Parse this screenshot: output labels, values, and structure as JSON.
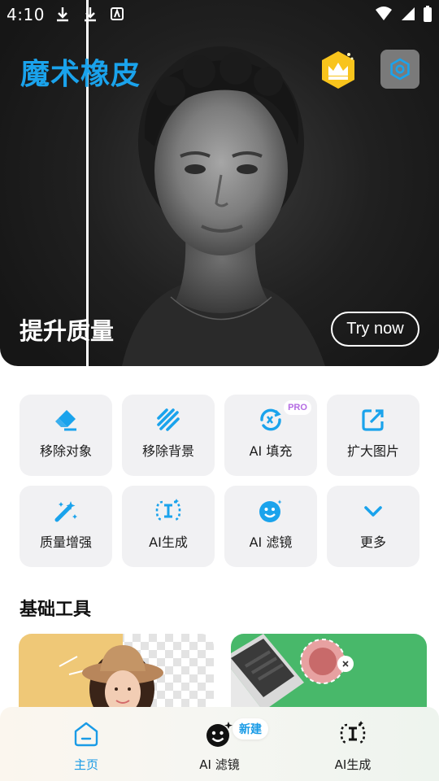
{
  "status_bar": {
    "time": "4:10"
  },
  "header": {
    "app_title": "魔术橡皮"
  },
  "hero": {
    "caption": "提升质量",
    "cta_label": "Try now"
  },
  "tools": [
    {
      "label": "移除对象",
      "icon": "eraser-icon"
    },
    {
      "label": "移除背景",
      "icon": "stripes-icon"
    },
    {
      "label": "AI 填充",
      "icon": "ai-fill-icon",
      "badge": "PRO"
    },
    {
      "label": "扩大图片",
      "icon": "expand-image-icon"
    },
    {
      "label": "质量增强",
      "icon": "magic-wand-icon"
    },
    {
      "label": "AI生成",
      "icon": "ai-text-icon"
    },
    {
      "label": "AI 滤镜",
      "icon": "smile-face-icon"
    },
    {
      "label": "更多",
      "icon": "chevron-down-icon"
    }
  ],
  "section": {
    "title": "基础工具"
  },
  "bottom_nav": {
    "items": [
      {
        "label": "主页",
        "icon": "home-icon",
        "active": true
      },
      {
        "label": "AI 滤镜",
        "icon": "smile-face-icon",
        "badge": "新建"
      },
      {
        "label": "AI生成",
        "icon": "ai-text-icon"
      }
    ]
  },
  "colors": {
    "accent": "#1aa3ec",
    "pro_badge": "#b46be3",
    "card_left_bg": "#efc877",
    "card_right_bg": "#48b86a"
  }
}
